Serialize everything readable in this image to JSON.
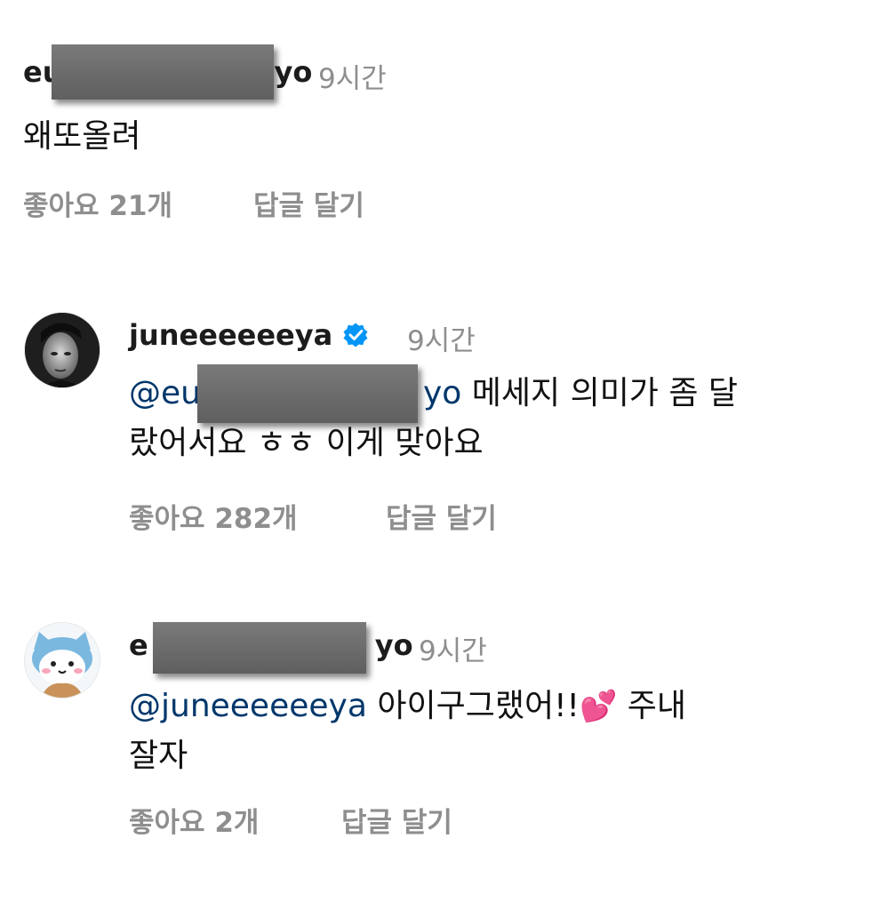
{
  "comments": [
    {
      "username_prefix": "eu",
      "username_suffix": "yo",
      "time": "9시간",
      "text": "왜또올려",
      "likes": "좋아요 21개",
      "reply": "답글 달기"
    },
    {
      "username": "juneeeeeeya",
      "verified": true,
      "time": "9시간",
      "mention_prefix": "@eu",
      "mention_suffix": "yo",
      "text_line1": "메세지 의미가 좀 달",
      "text_line2": "랐어서요 ㅎㅎ 이게 맞아요",
      "likes": "좋아요 282개",
      "reply": "답글 달기"
    },
    {
      "username_prefix": "e",
      "username_suffix": "yo",
      "time": "9시간",
      "mention": "@juneeeeeeya",
      "text_line1": "아이구그랬어!!",
      "emoji": "💕",
      "text_line1_end": "주내",
      "text_line2": "잘자",
      "likes": "좋아요 2개",
      "reply": "답글 달기"
    }
  ],
  "icons": {
    "verified": "verified-badge-icon",
    "emoji": "two-hearts-icon"
  },
  "colors": {
    "mention": "#00376b",
    "secondary": "#8e8e8e",
    "verified": "#0095f6"
  }
}
